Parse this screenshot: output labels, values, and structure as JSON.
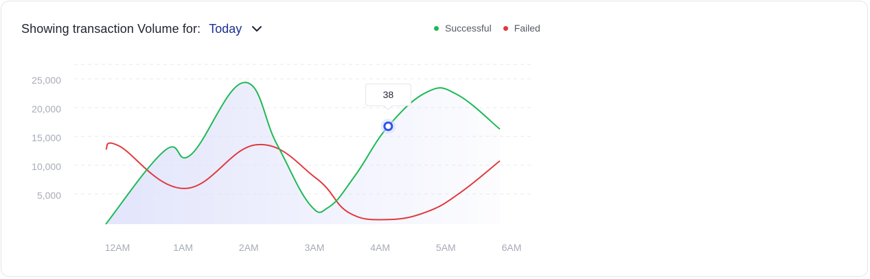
{
  "header": {
    "title": "Showing transaction Volume for:",
    "period": "Today"
  },
  "colors": {
    "successful": "#1db954",
    "failed": "#e0393e",
    "accent": "#1b2f8f",
    "marker": "#2f54eb",
    "area": "#dfe2fb"
  },
  "chart_data": {
    "type": "line",
    "x": [
      "12AM",
      "1AM",
      "2AM",
      "3AM",
      "4AM",
      "5AM",
      "6AM"
    ],
    "ylim": [
      0,
      27500
    ],
    "yticks": [
      5000,
      10000,
      15000,
      20000,
      25000
    ],
    "ytick_labels": [
      "5,000",
      "10,000",
      "15,000",
      "20,000",
      "25,000"
    ],
    "legend_position": "top",
    "grid": true,
    "series": [
      {
        "name": "Successful",
        "x": [
          0,
          0.9,
          1.3,
          2.1,
          2.6,
          3.1,
          3.4,
          3.8,
          4.3,
          4.9,
          5.35,
          6.0
        ],
        "values": [
          0,
          12800,
          12100,
          24600,
          14000,
          3500,
          3000,
          8500,
          17000,
          23000,
          22500,
          16500
        ]
      },
      {
        "name": "Failed",
        "x": [
          0,
          0.2,
          1.2,
          2.3,
          3.2,
          3.7,
          4.3,
          4.9,
          5.4,
          6.0
        ],
        "values": [
          13000,
          13600,
          6200,
          13800,
          8000,
          2000,
          800,
          2200,
          5500,
          11000
        ]
      }
    ],
    "tooltip": {
      "label": "38",
      "series": "Successful",
      "x": 4.3,
      "y": 17000
    }
  }
}
